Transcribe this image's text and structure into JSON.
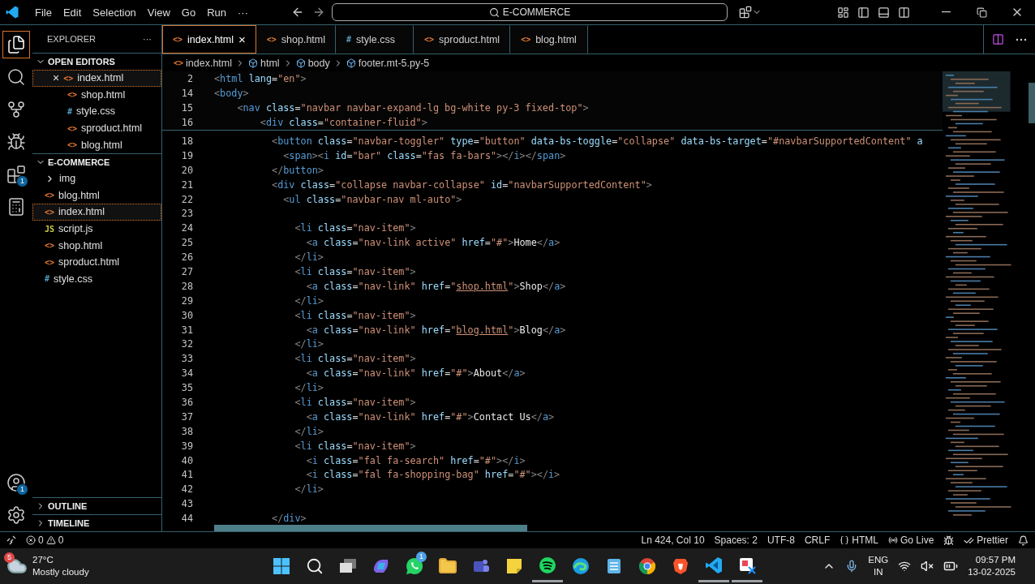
{
  "menu": [
    "File",
    "Edit",
    "Selection",
    "View",
    "Go",
    "Run",
    "···"
  ],
  "command_center": {
    "text": "E-COMMERCE"
  },
  "activity_bar": [
    {
      "kind": "explorer",
      "selected": true
    },
    {
      "kind": "search",
      "selected": false
    },
    {
      "kind": "source-control",
      "selected": false
    },
    {
      "kind": "run",
      "selected": false
    },
    {
      "kind": "extensions",
      "selected": false,
      "badge": "1"
    },
    {
      "kind": "calculator",
      "selected": false
    }
  ],
  "activity_bottom": [
    {
      "kind": "account",
      "badge": "1"
    },
    {
      "kind": "settings"
    }
  ],
  "sidebar": {
    "title": "EXPLORER",
    "more": "···",
    "sections": [
      {
        "title": "OPEN EDITORS",
        "expanded": true,
        "close": "×",
        "items": [
          {
            "name": "index.html",
            "icon": "<>",
            "kind": "html",
            "selected": true
          },
          {
            "name": "shop.html",
            "icon": "<>",
            "kind": "html",
            "selected": false
          },
          {
            "name": "style.css",
            "icon": "#",
            "kind": "css",
            "selected": false
          },
          {
            "name": "sproduct.html",
            "icon": "<>",
            "kind": "html",
            "selected": false
          },
          {
            "name": "blog.html",
            "icon": "<>",
            "kind": "html",
            "selected": false
          }
        ]
      },
      {
        "title": "E-COMMERCE",
        "expanded": true,
        "items": [
          {
            "name": "img",
            "kind": "folder",
            "expanded": false,
            "selected": false
          },
          {
            "name": "blog.html",
            "icon": "<>",
            "kind": "html",
            "selected": false
          },
          {
            "name": "index.html",
            "icon": "<>",
            "kind": "html",
            "selected": true
          },
          {
            "name": "script.js",
            "icon": "JS",
            "kind": "js",
            "selected": false
          },
          {
            "name": "shop.html",
            "icon": "<>",
            "kind": "html",
            "selected": false
          },
          {
            "name": "sproduct.html",
            "icon": "<>",
            "kind": "html",
            "selected": false
          },
          {
            "name": "style.css",
            "icon": "#",
            "kind": "css",
            "selected": false
          }
        ]
      }
    ],
    "collapsed": [
      {
        "title": "OUTLINE",
        "expanded": false
      },
      {
        "title": "TIMELINE",
        "expanded": false
      }
    ]
  },
  "tabs": [
    {
      "label": "index.html",
      "icon": "<>",
      "kind": "html",
      "selected": true,
      "close": "×"
    },
    {
      "label": "shop.html",
      "icon": "<>",
      "kind": "html",
      "selected": false
    },
    {
      "label": "style.css",
      "icon": "#",
      "kind": "css",
      "selected": false
    },
    {
      "label": "sproduct.html",
      "icon": "<>",
      "kind": "html",
      "selected": false
    },
    {
      "label": "blog.html",
      "icon": "<>",
      "kind": "html",
      "selected": false
    }
  ],
  "breadcrumb": [
    {
      "label": "index.html",
      "icon": "<>",
      "kind": "file"
    },
    {
      "label": "html",
      "kind": "element"
    },
    {
      "label": "body",
      "kind": "element"
    },
    {
      "label": "footer.mt-5.py-5",
      "kind": "element"
    }
  ],
  "sticky_lines": [
    {
      "number": "2",
      "tokens": [
        {
          "kind": "punct",
          "text": "<"
        },
        {
          "kind": "tag",
          "text": "html"
        },
        {
          "kind": "attr",
          "text": " lang"
        },
        {
          "kind": "plain",
          "text": "="
        },
        {
          "kind": "string",
          "text": "\"en\""
        },
        {
          "kind": "punct",
          "text": ">"
        }
      ]
    },
    {
      "number": "14",
      "tokens": [
        {
          "kind": "punct",
          "text": "<"
        },
        {
          "kind": "tag",
          "text": "body"
        },
        {
          "kind": "punct",
          "text": ">"
        }
      ]
    },
    {
      "number": "15",
      "tokens": [
        {
          "kind": "punct",
          "text": "    <"
        },
        {
          "kind": "tag",
          "text": "nav"
        },
        {
          "kind": "attr",
          "text": " class"
        },
        {
          "kind": "plain",
          "text": "="
        },
        {
          "kind": "string",
          "text": "\"navbar navbar-expand-lg bg-white py-3 fixed-top\""
        },
        {
          "kind": "punct",
          "text": ">"
        }
      ]
    },
    {
      "number": "16",
      "tokens": [
        {
          "kind": "punct",
          "text": "        <"
        },
        {
          "kind": "tag",
          "text": "div"
        },
        {
          "kind": "attr",
          "text": " class"
        },
        {
          "kind": "plain",
          "text": "="
        },
        {
          "kind": "string",
          "text": "\"container-fluid\""
        },
        {
          "kind": "punct",
          "text": ">"
        }
      ]
    }
  ],
  "lines": [
    {
      "number": "18",
      "tokens": [
        {
          "kind": "punct",
          "text": "          <"
        },
        {
          "kind": "tag",
          "text": "button"
        },
        {
          "kind": "attr",
          "text": " class"
        },
        {
          "kind": "plain",
          "text": "="
        },
        {
          "kind": "string",
          "text": "\"navbar-toggler\""
        },
        {
          "kind": "attr",
          "text": " type"
        },
        {
          "kind": "plain",
          "text": "="
        },
        {
          "kind": "string",
          "text": "\"button\""
        },
        {
          "kind": "attr",
          "text": " data-bs-toggle"
        },
        {
          "kind": "plain",
          "text": "="
        },
        {
          "kind": "string",
          "text": "\"collapse\""
        },
        {
          "kind": "attr",
          "text": " data-bs-target"
        },
        {
          "kind": "plain",
          "text": "="
        },
        {
          "kind": "string",
          "text": "\"#navbarSupportedContent\""
        },
        {
          "kind": "attr",
          "text": " a"
        }
      ]
    },
    {
      "number": "19",
      "tokens": [
        {
          "kind": "punct",
          "text": "            <"
        },
        {
          "kind": "tag",
          "text": "span"
        },
        {
          "kind": "punct",
          "text": "><"
        },
        {
          "kind": "tag",
          "text": "i"
        },
        {
          "kind": "attr",
          "text": " id"
        },
        {
          "kind": "plain",
          "text": "="
        },
        {
          "kind": "string",
          "text": "\"bar\""
        },
        {
          "kind": "attr",
          "text": " class"
        },
        {
          "kind": "plain",
          "text": "="
        },
        {
          "kind": "string",
          "text": "\"fas fa-bars\""
        },
        {
          "kind": "punct",
          "text": "></"
        },
        {
          "kind": "tag",
          "text": "i"
        },
        {
          "kind": "punct",
          "text": "></"
        },
        {
          "kind": "tag",
          "text": "span"
        },
        {
          "kind": "punct",
          "text": ">"
        }
      ]
    },
    {
      "number": "20",
      "tokens": [
        {
          "kind": "punct",
          "text": "          </"
        },
        {
          "kind": "tag",
          "text": "button"
        },
        {
          "kind": "punct",
          "text": ">"
        }
      ]
    },
    {
      "number": "21",
      "tokens": [
        {
          "kind": "punct",
          "text": "          <"
        },
        {
          "kind": "tag",
          "text": "div"
        },
        {
          "kind": "attr",
          "text": " class"
        },
        {
          "kind": "plain",
          "text": "="
        },
        {
          "kind": "string",
          "text": "\"collapse navbar-collapse\""
        },
        {
          "kind": "attr",
          "text": " id"
        },
        {
          "kind": "plain",
          "text": "="
        },
        {
          "kind": "string",
          "text": "\"navbarSupportedContent\""
        },
        {
          "kind": "punct",
          "text": ">"
        }
      ]
    },
    {
      "number": "22",
      "tokens": [
        {
          "kind": "punct",
          "text": "            <"
        },
        {
          "kind": "tag",
          "text": "ul"
        },
        {
          "kind": "attr",
          "text": " class"
        },
        {
          "kind": "plain",
          "text": "="
        },
        {
          "kind": "string",
          "text": "\"navbar-nav ml-auto\""
        },
        {
          "kind": "punct",
          "text": ">"
        }
      ]
    },
    {
      "number": "23"
    },
    {
      "number": "24",
      "tokens": [
        {
          "kind": "punct",
          "text": "              <"
        },
        {
          "kind": "tag",
          "text": "li"
        },
        {
          "kind": "attr",
          "text": " class"
        },
        {
          "kind": "plain",
          "text": "="
        },
        {
          "kind": "string",
          "text": "\"nav-item\""
        },
        {
          "kind": "punct",
          "text": ">"
        }
      ]
    },
    {
      "number": "25",
      "tokens": [
        {
          "kind": "punct",
          "text": "                <"
        },
        {
          "kind": "tag",
          "text": "a"
        },
        {
          "kind": "attr",
          "text": " class"
        },
        {
          "kind": "plain",
          "text": "="
        },
        {
          "kind": "string",
          "text": "\"nav-link active\""
        },
        {
          "kind": "attr",
          "text": " href"
        },
        {
          "kind": "plain",
          "text": "="
        },
        {
          "kind": "string",
          "text": "\"#\""
        },
        {
          "kind": "punct",
          "text": ">"
        },
        {
          "kind": "text",
          "text": "Home"
        },
        {
          "kind": "punct",
          "text": "</"
        },
        {
          "kind": "tag",
          "text": "a"
        },
        {
          "kind": "punct",
          "text": ">"
        }
      ]
    },
    {
      "number": "26",
      "tokens": [
        {
          "kind": "punct",
          "text": "              </"
        },
        {
          "kind": "tag",
          "text": "li"
        },
        {
          "kind": "punct",
          "text": ">"
        }
      ]
    },
    {
      "number": "27",
      "tokens": [
        {
          "kind": "punct",
          "text": "              <"
        },
        {
          "kind": "tag",
          "text": "li"
        },
        {
          "kind": "attr",
          "text": " class"
        },
        {
          "kind": "plain",
          "text": "="
        },
        {
          "kind": "string",
          "text": "\"nav-item\""
        },
        {
          "kind": "punct",
          "text": ">"
        }
      ]
    },
    {
      "number": "28",
      "tokens": [
        {
          "kind": "punct",
          "text": "                <"
        },
        {
          "kind": "tag",
          "text": "a"
        },
        {
          "kind": "attr",
          "text": " class"
        },
        {
          "kind": "plain",
          "text": "="
        },
        {
          "kind": "string",
          "text": "\"nav-link\""
        },
        {
          "kind": "attr",
          "text": " href"
        },
        {
          "kind": "plain",
          "text": "="
        },
        {
          "kind": "string",
          "text": "\""
        },
        {
          "kind": "link",
          "text": "shop.html"
        },
        {
          "kind": "string",
          "text": "\""
        },
        {
          "kind": "punct",
          "text": ">"
        },
        {
          "kind": "text",
          "text": "Shop"
        },
        {
          "kind": "punct",
          "text": "</"
        },
        {
          "kind": "tag",
          "text": "a"
        },
        {
          "kind": "punct",
          "text": ">"
        }
      ]
    },
    {
      "number": "29",
      "tokens": [
        {
          "kind": "punct",
          "text": "              </"
        },
        {
          "kind": "tag",
          "text": "li"
        },
        {
          "kind": "punct",
          "text": ">"
        }
      ]
    },
    {
      "number": "30",
      "tokens": [
        {
          "kind": "punct",
          "text": "              <"
        },
        {
          "kind": "tag",
          "text": "li"
        },
        {
          "kind": "attr",
          "text": " class"
        },
        {
          "kind": "plain",
          "text": "="
        },
        {
          "kind": "string",
          "text": "\"nav-item\""
        },
        {
          "kind": "punct",
          "text": ">"
        }
      ]
    },
    {
      "number": "31",
      "tokens": [
        {
          "kind": "punct",
          "text": "                <"
        },
        {
          "kind": "tag",
          "text": "a"
        },
        {
          "kind": "attr",
          "text": " class"
        },
        {
          "kind": "plain",
          "text": "="
        },
        {
          "kind": "string",
          "text": "\"nav-link\""
        },
        {
          "kind": "attr",
          "text": " href"
        },
        {
          "kind": "plain",
          "text": "="
        },
        {
          "kind": "string",
          "text": "\""
        },
        {
          "kind": "link",
          "text": "blog.html"
        },
        {
          "kind": "string",
          "text": "\""
        },
        {
          "kind": "punct",
          "text": ">"
        },
        {
          "kind": "text",
          "text": "Blog"
        },
        {
          "kind": "punct",
          "text": "</"
        },
        {
          "kind": "tag",
          "text": "a"
        },
        {
          "kind": "punct",
          "text": ">"
        }
      ]
    },
    {
      "number": "32",
      "tokens": [
        {
          "kind": "punct",
          "text": "              </"
        },
        {
          "kind": "tag",
          "text": "li"
        },
        {
          "kind": "punct",
          "text": ">"
        }
      ]
    },
    {
      "number": "33",
      "tokens": [
        {
          "kind": "punct",
          "text": "              <"
        },
        {
          "kind": "tag",
          "text": "li"
        },
        {
          "kind": "attr",
          "text": " class"
        },
        {
          "kind": "plain",
          "text": "="
        },
        {
          "kind": "string",
          "text": "\"nav-item\""
        },
        {
          "kind": "punct",
          "text": ">"
        }
      ]
    },
    {
      "number": "34",
      "tokens": [
        {
          "kind": "punct",
          "text": "                <"
        },
        {
          "kind": "tag",
          "text": "a"
        },
        {
          "kind": "attr",
          "text": " class"
        },
        {
          "kind": "plain",
          "text": "="
        },
        {
          "kind": "string",
          "text": "\"nav-link\""
        },
        {
          "kind": "attr",
          "text": " href"
        },
        {
          "kind": "plain",
          "text": "="
        },
        {
          "kind": "string",
          "text": "\"#\""
        },
        {
          "kind": "punct",
          "text": ">"
        },
        {
          "kind": "text",
          "text": "About"
        },
        {
          "kind": "punct",
          "text": "</"
        },
        {
          "kind": "tag",
          "text": "a"
        },
        {
          "kind": "punct",
          "text": ">"
        }
      ]
    },
    {
      "number": "35",
      "tokens": [
        {
          "kind": "punct",
          "text": "              </"
        },
        {
          "kind": "tag",
          "text": "li"
        },
        {
          "kind": "punct",
          "text": ">"
        }
      ]
    },
    {
      "number": "36",
      "tokens": [
        {
          "kind": "punct",
          "text": "              <"
        },
        {
          "kind": "tag",
          "text": "li"
        },
        {
          "kind": "attr",
          "text": " class"
        },
        {
          "kind": "plain",
          "text": "="
        },
        {
          "kind": "string",
          "text": "\"nav-item\""
        },
        {
          "kind": "punct",
          "text": ">"
        }
      ]
    },
    {
      "number": "37",
      "tokens": [
        {
          "kind": "punct",
          "text": "                <"
        },
        {
          "kind": "tag",
          "text": "a"
        },
        {
          "kind": "attr",
          "text": " class"
        },
        {
          "kind": "plain",
          "text": "="
        },
        {
          "kind": "string",
          "text": "\"nav-link\""
        },
        {
          "kind": "attr",
          "text": " href"
        },
        {
          "kind": "plain",
          "text": "="
        },
        {
          "kind": "string",
          "text": "\"#\""
        },
        {
          "kind": "punct",
          "text": ">"
        },
        {
          "kind": "text",
          "text": "Contact Us"
        },
        {
          "kind": "punct",
          "text": "</"
        },
        {
          "kind": "tag",
          "text": "a"
        },
        {
          "kind": "punct",
          "text": ">"
        }
      ]
    },
    {
      "number": "38",
      "tokens": [
        {
          "kind": "punct",
          "text": "              </"
        },
        {
          "kind": "tag",
          "text": "li"
        },
        {
          "kind": "punct",
          "text": ">"
        }
      ]
    },
    {
      "number": "39",
      "tokens": [
        {
          "kind": "punct",
          "text": "              <"
        },
        {
          "kind": "tag",
          "text": "li"
        },
        {
          "kind": "attr",
          "text": " class"
        },
        {
          "kind": "plain",
          "text": "="
        },
        {
          "kind": "string",
          "text": "\"nav-item\""
        },
        {
          "kind": "punct",
          "text": ">"
        }
      ]
    },
    {
      "number": "40",
      "tokens": [
        {
          "kind": "punct",
          "text": "                <"
        },
        {
          "kind": "tag",
          "text": "i"
        },
        {
          "kind": "attr",
          "text": " class"
        },
        {
          "kind": "plain",
          "text": "="
        },
        {
          "kind": "string",
          "text": "\"fal fa-search\""
        },
        {
          "kind": "attr",
          "text": " href"
        },
        {
          "kind": "plain",
          "text": "="
        },
        {
          "kind": "string",
          "text": "\"#\""
        },
        {
          "kind": "punct",
          "text": "></"
        },
        {
          "kind": "tag",
          "text": "i"
        },
        {
          "kind": "punct",
          "text": ">"
        }
      ]
    },
    {
      "number": "41",
      "tokens": [
        {
          "kind": "punct",
          "text": "                <"
        },
        {
          "kind": "tag",
          "text": "i"
        },
        {
          "kind": "attr",
          "text": " class"
        },
        {
          "kind": "plain",
          "text": "="
        },
        {
          "kind": "string",
          "text": "\"fal fa-shopping-bag\""
        },
        {
          "kind": "attr",
          "text": " href"
        },
        {
          "kind": "plain",
          "text": "="
        },
        {
          "kind": "string",
          "text": "\"#\""
        },
        {
          "kind": "punct",
          "text": "></"
        },
        {
          "kind": "tag",
          "text": "i"
        },
        {
          "kind": "punct",
          "text": ">"
        }
      ]
    },
    {
      "number": "42",
      "tokens": [
        {
          "kind": "punct",
          "text": "              </"
        },
        {
          "kind": "tag",
          "text": "li"
        },
        {
          "kind": "punct",
          "text": ">"
        }
      ]
    },
    {
      "number": "43"
    },
    {
      "number": "44",
      "tokens": [
        {
          "kind": "punct",
          "text": "          </"
        },
        {
          "kind": "tag",
          "text": "div"
        },
        {
          "kind": "punct",
          "text": ">"
        }
      ]
    }
  ],
  "status_bar": {
    "errors": "0",
    "warnings": "0",
    "items": [
      {
        "kind": "plain",
        "text": "Ln 424, Col 10"
      },
      {
        "kind": "plain",
        "text": "Spaces: 2"
      },
      {
        "kind": "plain",
        "text": "UTF-8"
      },
      {
        "kind": "plain",
        "text": "CRLF"
      },
      {
        "kind": "language",
        "text": "HTML"
      },
      {
        "kind": "live",
        "text": "Go Live"
      },
      {
        "kind": "copilot"
      },
      {
        "kind": "prettier",
        "text": "Prettier"
      },
      {
        "kind": "bell"
      }
    ]
  },
  "taskbar": {
    "weather": {
      "badge": "5",
      "temperature": "27°C",
      "condition": "Mostly cloudy"
    },
    "apps": [
      {
        "kind": "start",
        "running": false
      },
      {
        "kind": "search",
        "running": false
      },
      {
        "kind": "taskview",
        "running": false
      },
      {
        "kind": "copilot",
        "running": false
      },
      {
        "kind": "chat",
        "running": false,
        "badge": "1"
      },
      {
        "kind": "folder",
        "running": false
      },
      {
        "kind": "teams",
        "running": false
      },
      {
        "kind": "notes",
        "running": false
      },
      {
        "kind": "music",
        "running": true
      },
      {
        "kind": "edge",
        "running": false
      },
      {
        "kind": "notepad",
        "running": false
      },
      {
        "kind": "chrome",
        "running": false
      },
      {
        "kind": "brave",
        "running": false
      },
      {
        "kind": "vscode",
        "running": true
      },
      {
        "kind": "snip",
        "running": true
      }
    ],
    "language": [
      "ENG",
      "IN"
    ],
    "time": "09:57 PM",
    "date": "13-02-2025"
  }
}
